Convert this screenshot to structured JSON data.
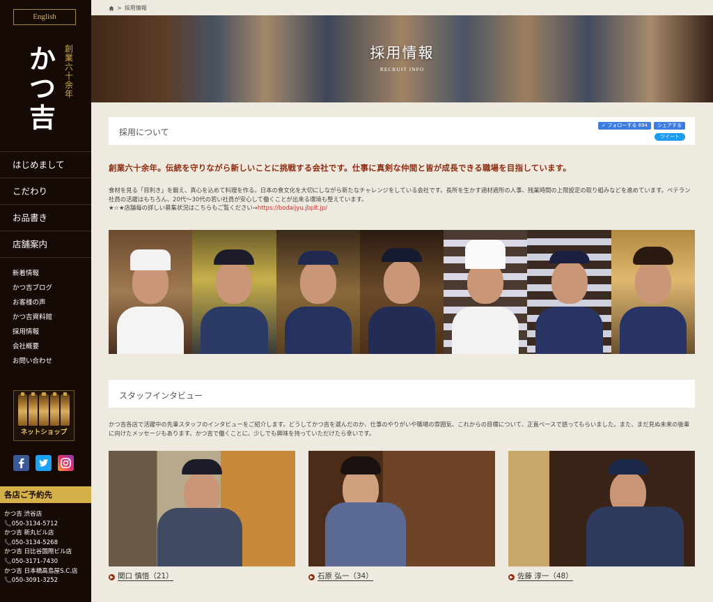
{
  "sidebar": {
    "lang_button": "English",
    "logo_main": "かつ吉",
    "logo_sub": "創業六十余年",
    "nav": [
      "はじめまして",
      "こだわり",
      "お品書き",
      "店舗案内"
    ],
    "subnav": [
      "新着情報",
      "かつ吉ブログ",
      "お客様の声",
      "かつ吉資料館",
      "採用情報",
      "会社概要",
      "お問い合わせ"
    ],
    "shop_label": "ネットショップ",
    "reserve_title": "各店ご予約先",
    "contacts": [
      "かつ吉 渋谷店",
      "📞050-3134-5712",
      "かつ吉 新丸ビル店",
      "📞050-3134-5268",
      "かつ吉 日比谷国際ビル店",
      "📞050-3171-7430",
      "かつ吉 日本橋高島屋S.C.店",
      "📞050-3091-3252"
    ]
  },
  "breadcrumb": {
    "home_icon": "house-icon",
    "separator": ">",
    "current": "採用情報"
  },
  "hero": {
    "title": "採用情報",
    "subtitle": "RECRUIT INFO"
  },
  "about": {
    "section_title": "採用について",
    "share_follow": "✓ フォローする 694",
    "share_share": "シェアする",
    "share_tweet": "ツイート",
    "headline": "創業六十余年。伝統を守りながら新しいことに挑戦する会社です。仕事に真剣な仲間と皆が成長できる職場を目指しています。",
    "paragraph1": "食材を見る「目利き」を鍛え、真心を込めて料理を作る。日本の食文化を大切にしながら新たなチャレンジをしている会社です。長所を生かす適材適所の人事、残業時間の上限設定の取り組みなどを進めています。ベテラン社員の活躍はもちろん、20代〜30代の若い社員が安心して働くことが出来る環境も整えています。",
    "paragraph2": "★☆★店舗毎の詳しい募集状況はこちらもご覧ください→",
    "link": "https://bodaijyu.jbplt.jp/"
  },
  "interview": {
    "section_title": "スタッフインタビュー",
    "intro": "かつ吉各店で活躍中の先輩スタッフのインタビューをご紹介します。どうしてかつ吉を選んだのか、仕事のやりがいや職場の雰囲気、これからの目標について、正直ベースで語ってもらいました。また、まだ見ぬ未来の後輩に向けたメッセージもあります。かつ吉で働くことに、少しでも興味を持っていただけたら幸いです。",
    "people": [
      {
        "name": "関口 慎悟（21）"
      },
      {
        "name": "石原 弘一（34）"
      },
      {
        "name": "佐藤 淳一（48）"
      }
    ]
  },
  "colors": {
    "sidebar_bg": "#150a06",
    "accent_gold": "#d4b14b",
    "headline_red": "#8c2e0f",
    "link_red": "#d0302a"
  }
}
